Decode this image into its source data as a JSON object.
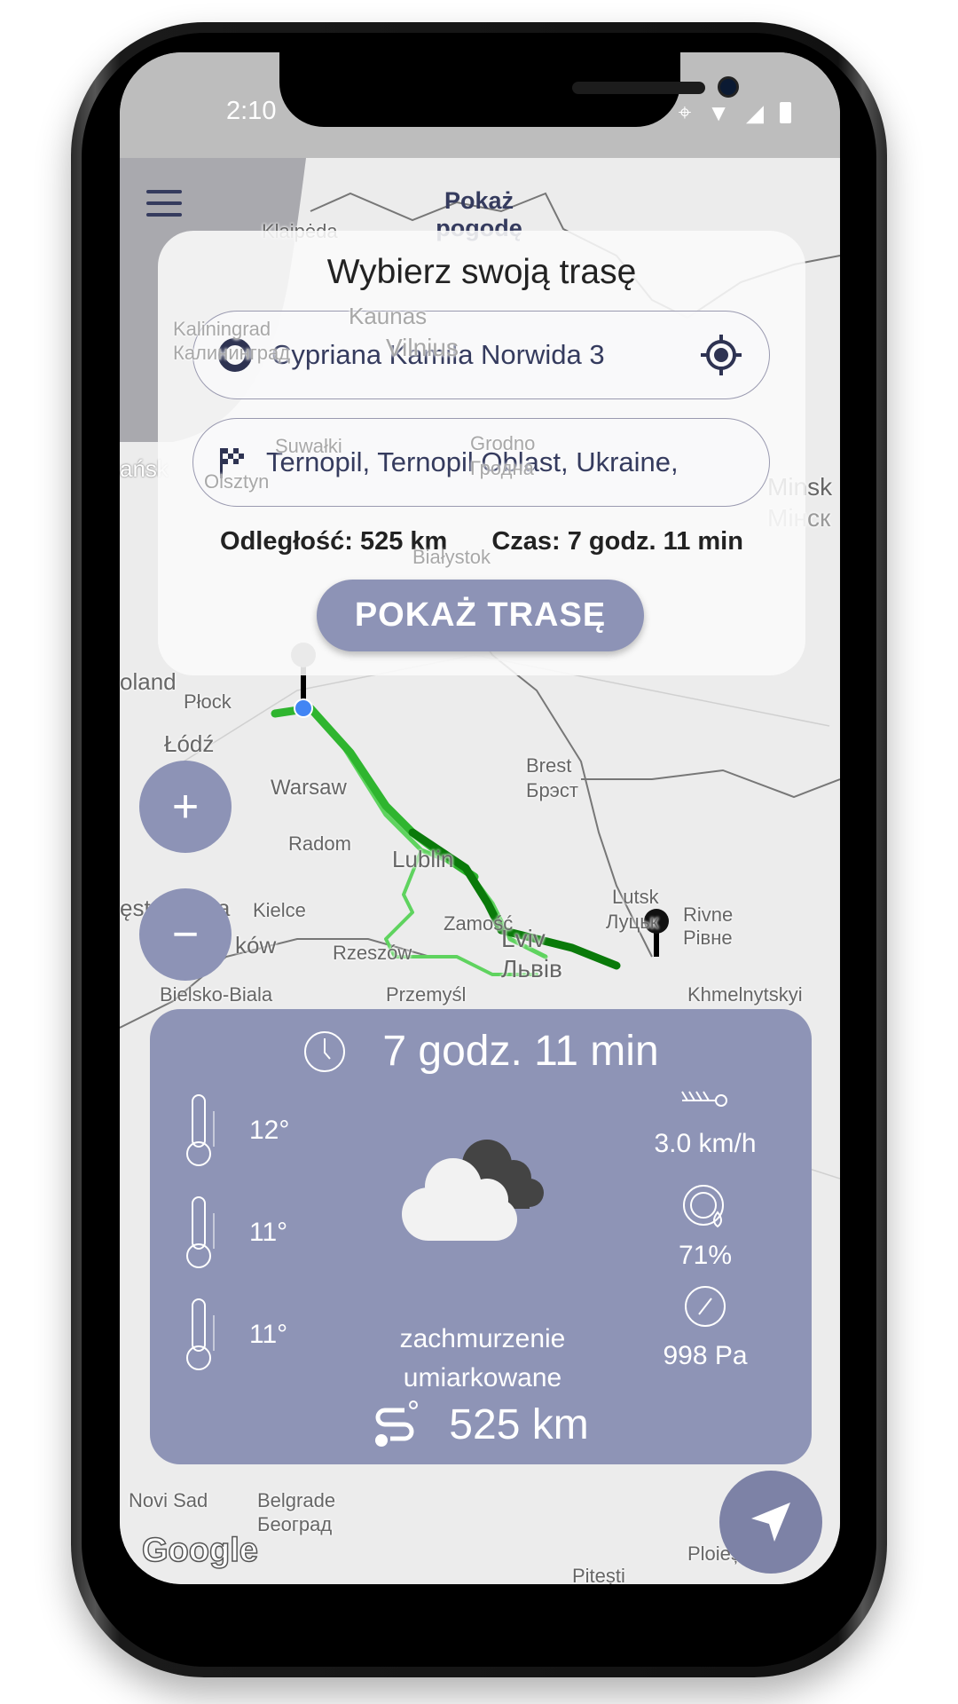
{
  "status_bar": {
    "time": "2:10"
  },
  "header": {
    "menu_icon": "hamburger-icon",
    "weather_link": "Pokaż pogodę"
  },
  "route_panel": {
    "title": "Wybierz swoją trasę",
    "origin": {
      "value": "Cypriana Kamila Norwida 3",
      "icon": "circle-origin-icon",
      "action_icon": "locate-icon"
    },
    "destination": {
      "value": "Ternopil, Ternopil Oblast, Ukraine,",
      "icon": "checkered-flag-icon"
    },
    "distance_label": "Odległość: 525 km",
    "time_label": "Czas: 7 godz. 11 min",
    "show_route_button": "POKAŻ TRASĘ"
  },
  "map": {
    "zoom_in": "+",
    "zoom_out": "−",
    "labels": [
      "Klaipėda",
      "Kaliningrad",
      "Калининград",
      "Vilnius",
      "Kaunas",
      "Minsk",
      "Мінск",
      "Olsztyn",
      "Suwałki",
      "Grodno",
      "Гродна",
      "Białystok",
      "ańsk",
      "oland",
      "Płock",
      "Warsaw",
      "Łódź",
      "Brest",
      "Брэст",
      "Radom",
      "Lublin",
      "ęstochowa",
      "Kielce",
      "Zamość",
      "Lutsk",
      "Луцьк",
      "Rivne",
      "Рівне",
      "Rzeszów",
      "Lviv",
      "Львів",
      "ków",
      "Bielsko-Biala",
      "Przemyśl",
      "Khmelnytskyi",
      "Novi Sad",
      "Belgrade",
      "Београд",
      "Pitești",
      "Ploiești"
    ],
    "attribution": "Google",
    "route_colors": [
      "#0a7a0a",
      "#2fb52f",
      "#5fd35f"
    ]
  },
  "weather_card": {
    "duration": "7 godz. 11 min",
    "temps": [
      "12°",
      "11°",
      "11°"
    ],
    "wind": "3.0 km/h",
    "humidity": "71%",
    "pressure": "998 Pa",
    "description_line1": "zachmurzenie",
    "description_line2": "umiarkowane",
    "distance": "525 km",
    "background_color": "#8e94b6"
  }
}
